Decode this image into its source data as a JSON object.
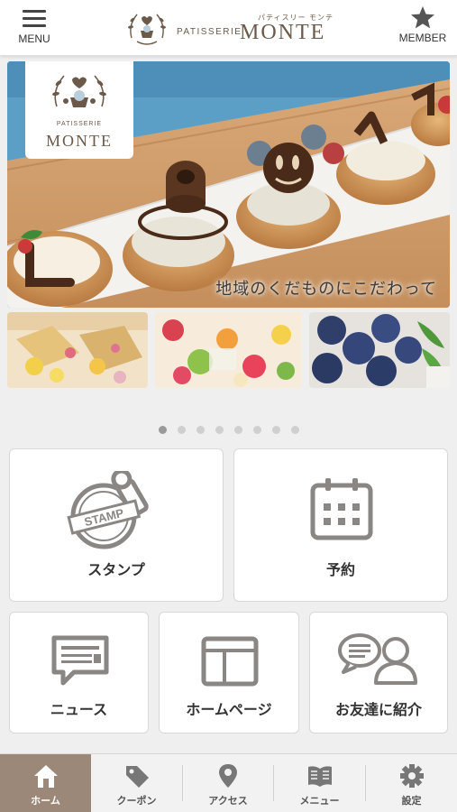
{
  "header": {
    "menu_label": "MENU",
    "member_label": "MEMBER",
    "brand_kana": "パティスリー モンテ",
    "brand_patisserie": "PATISSERIE",
    "brand_name": "MONTE"
  },
  "hero": {
    "logo_patisserie": "PATISSERIE",
    "logo_name": "MONTE",
    "caption": "地域のくだものにこだわって",
    "cookie_text": "LOVE"
  },
  "carousel": {
    "page_count": 8,
    "active_index": 0
  },
  "tiles": {
    "stamp_label": "スタンプ",
    "stamp_icon_text": "STAMP",
    "reservation_label": "予約",
    "news_label": "ニュース",
    "homepage_label": "ホームページ",
    "invite_label": "お友達に紹介"
  },
  "tabbar": {
    "home": "ホーム",
    "coupon": "クーポン",
    "access": "アクセス",
    "menu": "メニュー",
    "settings": "設定"
  },
  "colors": {
    "brand_brown": "#6b5a4a",
    "icon_gray": "#8a8683",
    "tab_active_bg": "#9b8879",
    "page_bg": "#efefef"
  }
}
